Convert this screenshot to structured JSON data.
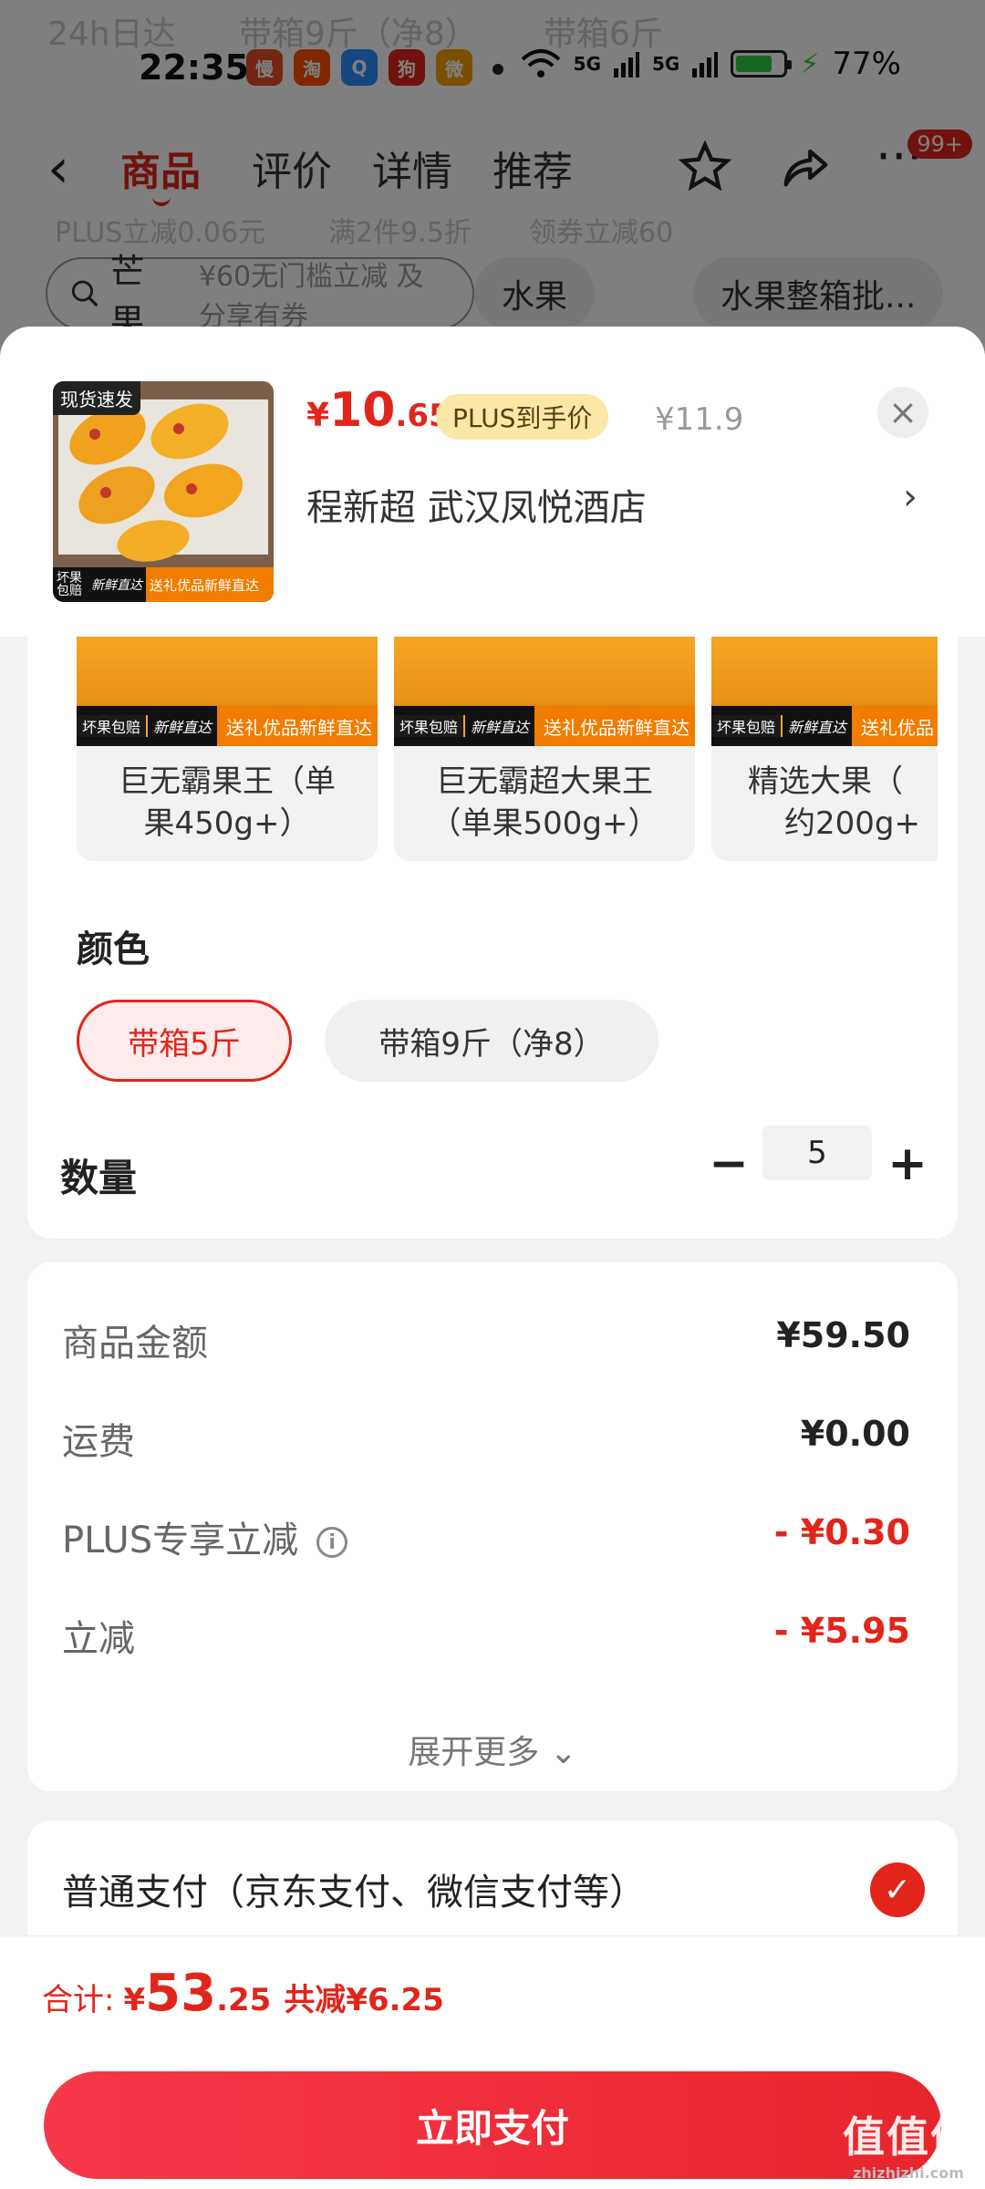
{
  "status_bar": {
    "time": "22:35",
    "apps": [
      {
        "name": "manman-icon",
        "glyph": "慢",
        "color": "#e44d26"
      },
      {
        "name": "taobao-icon",
        "glyph": "淘",
        "color": "#ff5000"
      },
      {
        "name": "qq-browser-icon",
        "glyph": "Q",
        "color": "#2b8cff"
      },
      {
        "name": "app-mascot-icon",
        "glyph": "狗",
        "color": "#e1251b"
      },
      {
        "name": "weibo-icon",
        "glyph": "微",
        "color": "#f0a000"
      }
    ],
    "signal1": "5G",
    "signal2": "5G",
    "battery": "77%",
    "battery_level": 0.77
  },
  "background": {
    "ghost_texts": [
      "24h日达",
      "带箱9斤（净8）",
      "带箱6斤",
      "PLUS立减0.06元",
      "满2件9.5折",
      "领券立减60",
      "¥60无门槛立减 及分享有券"
    ],
    "nav": {
      "back": "‹",
      "tabs": [
        "商品",
        "评价",
        "详情",
        "推荐"
      ],
      "badge": "99+"
    },
    "search": "芒果",
    "chips": [
      "水果",
      "水果整箱批..."
    ]
  },
  "sheet": {
    "thumb_tag": "现货速发",
    "thumb_banner_left": "坏果包赔",
    "thumb_banner_mid": "新鲜直达",
    "thumb_banner_right": "送礼优品新鲜直达",
    "price": {
      "symbol": "¥",
      "int": "10",
      "dec": ".65"
    },
    "plus_tag": "PLUS到手价",
    "original_price": "¥11.9",
    "close": "×",
    "address": "程新超  武汉凤悦酒店",
    "address_arrow": "›"
  },
  "spec_items": [
    {
      "line1": "巨无霸果王（单",
      "line2": "果450g+）",
      "badge_left": "坏果包赔",
      "badge_mid": "新鲜直达",
      "badge_right": "送礼优品新鲜直达"
    },
    {
      "line1": "巨无霸超大果王",
      "line2": "（单果500g+）",
      "badge_left": "坏果包赔",
      "badge_mid": "新鲜直达",
      "badge_right": "送礼优品新鲜直达"
    },
    {
      "line1": "精选大果（",
      "line2": "约200g+",
      "badge_left": "坏果包赔",
      "badge_mid": "新鲜直达",
      "badge_right": "送礼优品"
    }
  ],
  "color_section": {
    "title": "颜色",
    "options": [
      {
        "label": "带箱5斤",
        "selected": true
      },
      {
        "label": "带箱9斤（净8）",
        "selected": false
      }
    ]
  },
  "quantity": {
    "title": "数量",
    "minus": "−",
    "value": "5",
    "plus": "+"
  },
  "fees": [
    {
      "label": "商品金额",
      "value": "¥59.50",
      "red": false,
      "info": false
    },
    {
      "label": "运费",
      "value": "¥0.00",
      "red": false,
      "info": false
    },
    {
      "label": "PLUS专享立减",
      "value": "- ¥0.30",
      "red": true,
      "info": true
    },
    {
      "label": "立减",
      "value": "- ¥5.95",
      "red": true,
      "info": false
    }
  ],
  "expand_more": "展开更多 ⌄",
  "payment": {
    "label": "普通支付（京东支付、微信支付等）",
    "check": "✓"
  },
  "total": {
    "label": "合计:",
    "symbol": "¥",
    "int": "53",
    "dec": ".25",
    "saving": "共减¥6.25"
  },
  "pay_button": "立即支付",
  "watermark": {
    "line1": "值值值",
    "line2": "zhizhizhi.com"
  },
  "colors": {
    "accent": "#e1251b",
    "plus_tag_bg": "#fbe7a6"
  }
}
